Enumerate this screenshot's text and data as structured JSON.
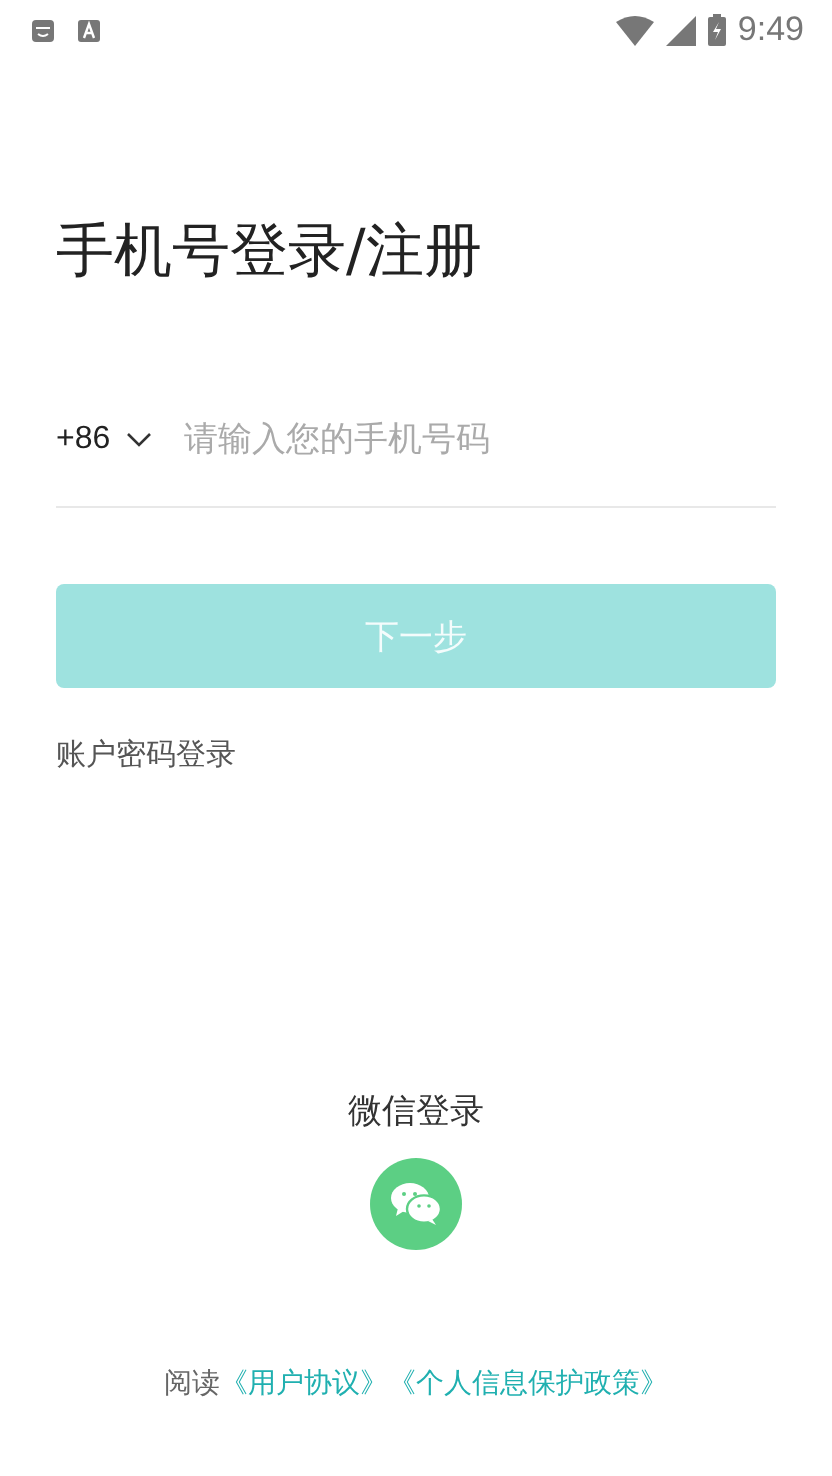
{
  "status_bar": {
    "time": "9:49"
  },
  "title": "手机号登录/注册",
  "phone": {
    "country_code": "+86",
    "placeholder": "请输入您的手机号码"
  },
  "next_button": {
    "label": "下一步",
    "disabled": true
  },
  "password_login": "账户密码登录",
  "wechat_login": {
    "label": "微信登录"
  },
  "agreement": {
    "prefix": "阅读",
    "links": [
      "《用户协议》",
      "《个人信息保护政策》"
    ]
  }
}
